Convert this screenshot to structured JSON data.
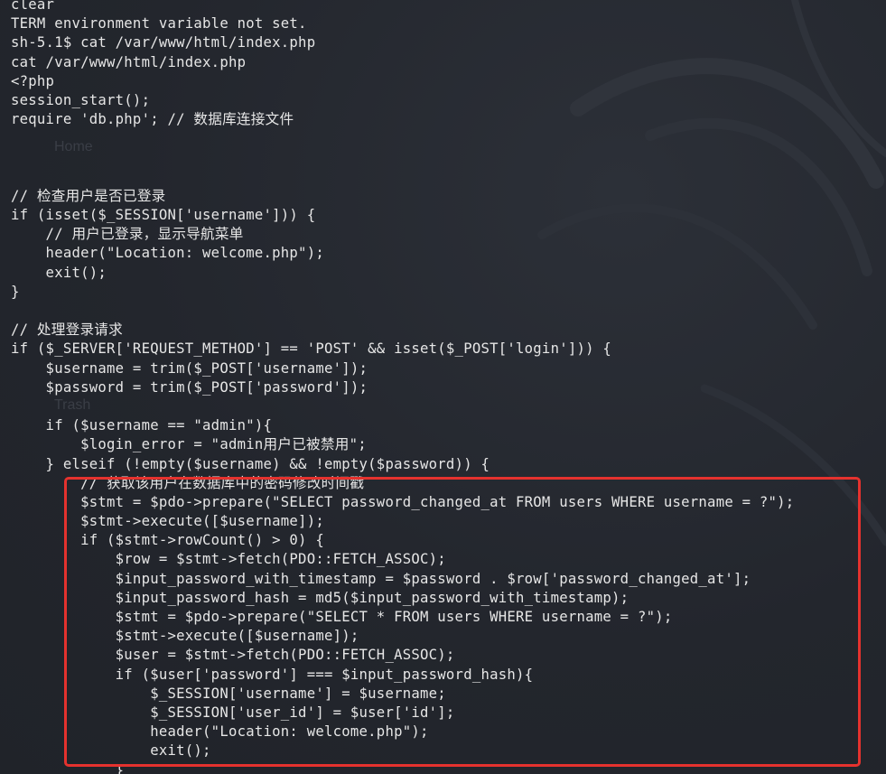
{
  "terminal": {
    "lines": [
      "clear",
      "TERM environment variable not set.",
      "sh-5.1$ cat /var/www/html/index.php",
      "cat /var/www/html/index.php",
      "<?php",
      "session_start();",
      "require 'db.php'; // 数据库连接文件",
      "",
      "",
      "",
      "// 检查用户是否已登录",
      "if (isset($_SESSION['username'])) {",
      "    // 用户已登录，显示导航菜单",
      "    header(\"Location: welcome.php\");",
      "    exit();",
      "}",
      "",
      "// 处理登录请求",
      "if ($_SERVER['REQUEST_METHOD'] == 'POST' && isset($_POST['login'])) {",
      "    $username = trim($_POST['username']);",
      "    $password = trim($_POST['password']);",
      "",
      "    if ($username == \"admin\"){",
      "        $login_error = \"admin用户已被禁用\";",
      "    } elseif (!empty($username) && !empty($password)) {",
      "        // 获取该用户在数据库中的密码修改时间戳",
      "        $stmt = $pdo->prepare(\"SELECT password_changed_at FROM users WHERE username = ?\");",
      "        $stmt->execute([$username]);",
      "        if ($stmt->rowCount() > 0) {",
      "            $row = $stmt->fetch(PDO::FETCH_ASSOC);",
      "            $input_password_with_timestamp = $password . $row['password_changed_at'];",
      "            $input_password_hash = md5($input_password_with_timestamp);",
      "            $stmt = $pdo->prepare(\"SELECT * FROM users WHERE username = ?\");",
      "            $stmt->execute([$username]);",
      "            $user = $stmt->fetch(PDO::FETCH_ASSOC);",
      "            if ($user['password'] === $input_password_hash){",
      "                $_SESSION['username'] = $username;",
      "                $_SESSION['user_id'] = $user['id'];",
      "                header(\"Location: welcome.php\");",
      "                exit();",
      "            }"
    ]
  },
  "ghost_text": {
    "home": "Home",
    "trash": "Trash"
  },
  "colors": {
    "background": "#24272e",
    "text": "#e6e6e6",
    "highlight": "#e5322e"
  }
}
